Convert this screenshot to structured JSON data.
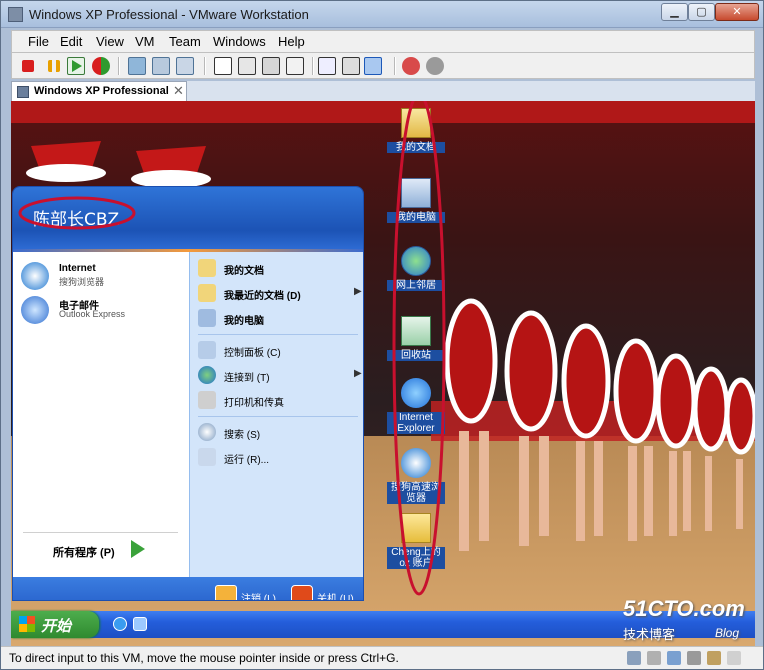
{
  "window": {
    "title": "Windows XP Professional - VMware Workstation",
    "min_glyph": "▁",
    "max_glyph": "▢",
    "close_glyph": "✕"
  },
  "menu": [
    "File",
    "Edit",
    "View",
    "VM",
    "Team",
    "Windows",
    "Help"
  ],
  "tab": {
    "label": "Windows XP Professional",
    "close_glyph": "✕"
  },
  "desktop_icons": [
    {
      "label": "我的文档",
      "icon": "my-documents-icon"
    },
    {
      "label": "我的电脑",
      "icon": "my-computer-icon"
    },
    {
      "label": "网上邻居",
      "icon": "network-places-icon"
    },
    {
      "label": "回收站",
      "icon": "recycle-bin-icon"
    },
    {
      "label": "Internet Explorer",
      "icon": "internet-explorer-icon"
    },
    {
      "label": "搜狗高速浏览器",
      "icon": "sogou-browser-icon"
    },
    {
      "label": "Cheng上的oz 账户",
      "icon": "folder-icon"
    }
  ],
  "start_menu": {
    "user": "陈部长CBZ",
    "pinned": [
      {
        "title": "Internet",
        "subtitle": "搜狗浏览器"
      },
      {
        "title": "电子邮件",
        "subtitle": "Outlook Express"
      }
    ],
    "all_programs": "所有程序 (P)",
    "right_items": [
      {
        "label": "我的文档",
        "bold": true,
        "arrow": false
      },
      {
        "label": "我最近的文档 (D)",
        "bold": true,
        "arrow": true
      },
      {
        "label": "我的电脑",
        "bold": true,
        "arrow": false
      },
      {
        "label": "控制面板 (C)",
        "bold": false,
        "arrow": false
      },
      {
        "label": "连接到 (T)",
        "bold": false,
        "arrow": true
      },
      {
        "label": "打印机和传真",
        "bold": false,
        "arrow": false
      },
      {
        "label": "搜索 (S)",
        "bold": false,
        "arrow": false
      },
      {
        "label": "运行 (R)...",
        "bold": false,
        "arrow": false
      }
    ],
    "logoff": "注销 (L)",
    "shutdown": "关机 (U)"
  },
  "taskbar": {
    "start": "开始"
  },
  "watermark": {
    "site": "51CTO.com",
    "sub": "技术博客",
    "blog": "Blog"
  },
  "status_text": "To direct input to this VM, move the mouse pointer inside or press Ctrl+G.",
  "colors": {
    "annotation": "#c8102e",
    "xp_blue": "#245edb",
    "start_green": "#3a9a3a"
  }
}
